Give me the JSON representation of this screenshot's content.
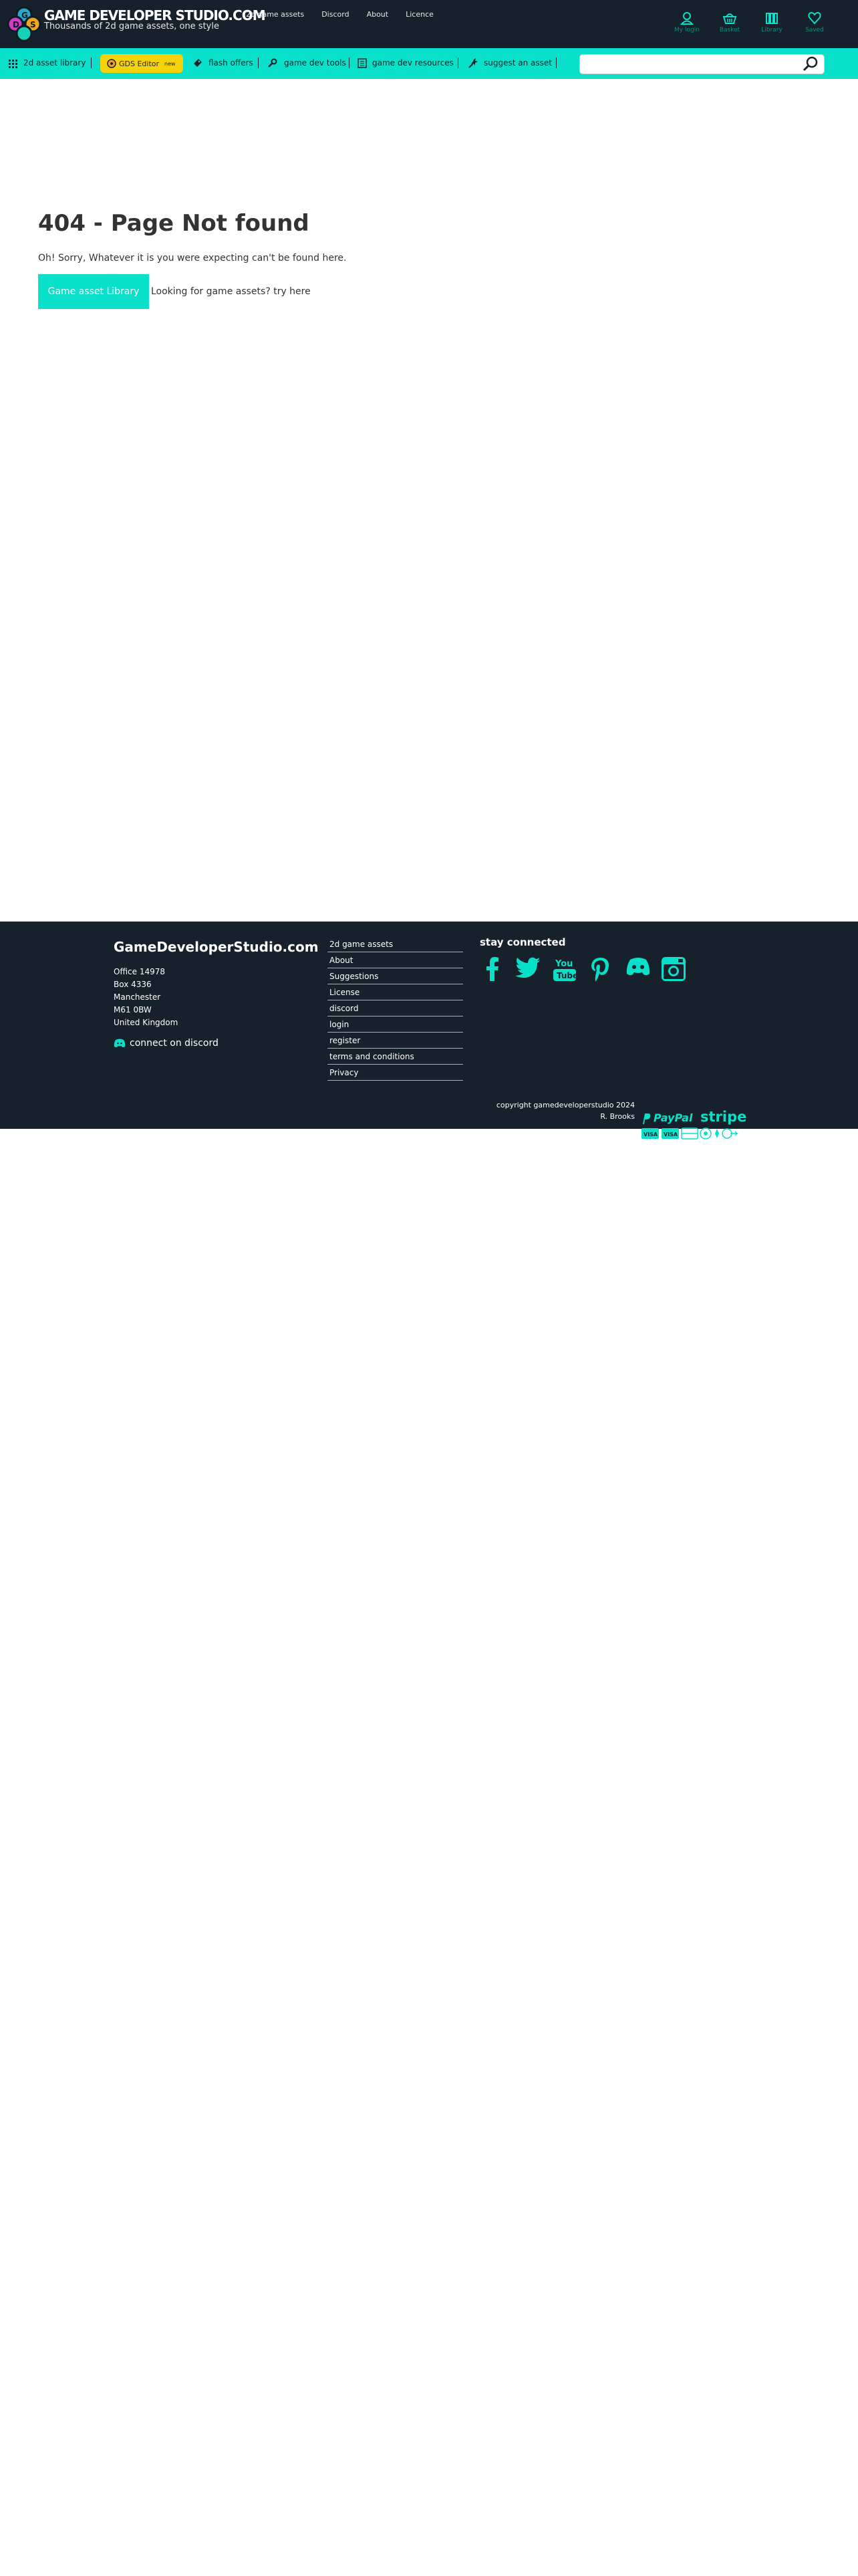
{
  "header": {
    "brand": "GAME DEVELOPER STUDIO.COM",
    "tagline": "Thousands of 2d game assets, one style",
    "nav": [
      "2d game assets",
      "Discord",
      "About",
      "Licence"
    ],
    "user_icons": [
      {
        "label": "My login",
        "icon": "user-icon"
      },
      {
        "label": "Basket",
        "icon": "basket-icon"
      },
      {
        "label": "Library",
        "icon": "library-icon"
      },
      {
        "label": "Saved",
        "icon": "heart-icon"
      }
    ]
  },
  "subnav": {
    "library": "2d asset library",
    "editor": "GDS Editor",
    "editor_badge": "new",
    "flash": "flash offers",
    "tools": "game dev tools",
    "resources": "game dev resources",
    "suggest": "suggest an asset",
    "search_value": ""
  },
  "main": {
    "title": "404 - Page Not found",
    "message": "Oh! Sorry, Whatever it is you were expecting can't be found here.",
    "button": "Game asset Library",
    "hint": "Looking for game assets? try here"
  },
  "footer": {
    "title": "GameDeveloperStudio.com",
    "address": [
      "Office 14978",
      "Box 4336",
      "Manchester",
      "M61 0BW",
      "United Kingdom"
    ],
    "discord": "connect on discord",
    "links": [
      "2d game assets",
      "About",
      "Suggestions",
      "License",
      "discord",
      "login",
      "register",
      "terms and conditions",
      "Privacy"
    ],
    "stay": "stay connected",
    "social_icons": [
      "facebook-icon",
      "twitter-icon",
      "youtube-icon",
      "pinterest-icon",
      "discord-icon",
      "instagram-icon"
    ],
    "copyright": "copyright gamedeveloperstudio 2024",
    "owner": "R. Brooks",
    "paypal": "PayPal",
    "stripe": "stripe"
  },
  "colors": {
    "dark": "#17212b",
    "accent": "#08e0c9",
    "editor": "#f5d20a"
  }
}
